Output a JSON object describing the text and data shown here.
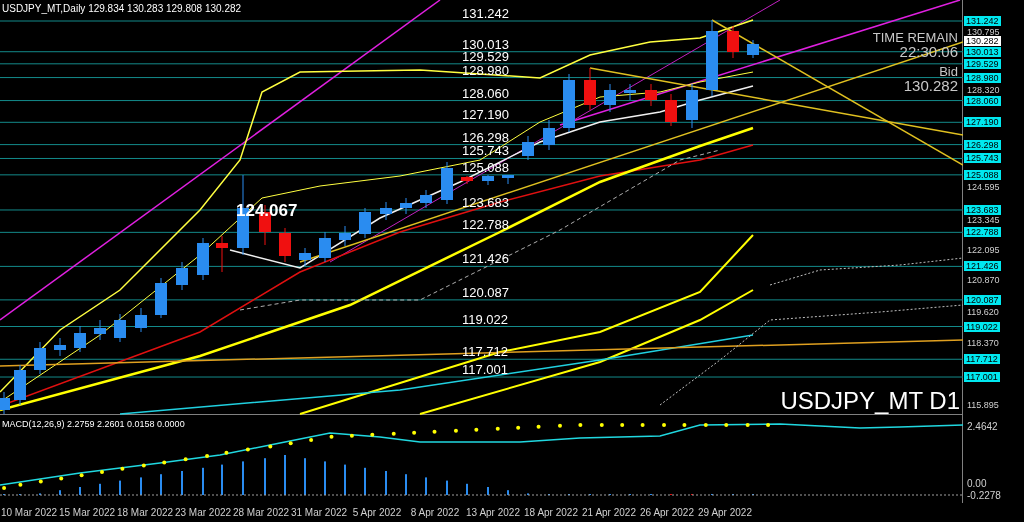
{
  "header": {
    "symbol": "USDJPY_MT,Daily",
    "ohlc": "129.834 130.283 129.808 130.282"
  },
  "levels": [
    {
      "chart_label": "131.242",
      "axis_tag": "131.242"
    },
    {
      "chart_label": "130.013",
      "axis_tag": "130.013"
    },
    {
      "chart_label": "129.529",
      "axis_tag": "129.529"
    },
    {
      "chart_label": "128.980",
      "axis_tag": "128.980"
    },
    {
      "chart_label": "128.060",
      "axis_tag": "128.060"
    },
    {
      "chart_label": "127.190",
      "axis_tag": "127.190"
    },
    {
      "chart_label": "126.298",
      "axis_tag": "126.298"
    },
    {
      "chart_label": "125.743",
      "axis_tag": "125.743"
    },
    {
      "chart_label": "125.088",
      "axis_tag": "125.088"
    },
    {
      "chart_label": "123.683",
      "axis_tag": "123.683"
    },
    {
      "chart_label": "122.788",
      "axis_tag": "122.788"
    },
    {
      "chart_label": "121.426",
      "axis_tag": "121.426"
    },
    {
      "chart_label": "120.087",
      "axis_tag": "120.087"
    },
    {
      "chart_label": "119.022",
      "axis_tag": "119.022"
    },
    {
      "chart_label": "117.712",
      "axis_tag": "117.712"
    },
    {
      "chart_label": "117.001",
      "axis_tag": "117.001"
    }
  ],
  "marker_label": "124.067",
  "price_ticks": [
    "130.795",
    "128.320",
    "124.595",
    "123.345",
    "122.095",
    "120.870",
    "119.620",
    "118.370",
    "115.895"
  ],
  "bid_tag": "130.282",
  "info": {
    "time_title": "TIME REMAIN",
    "time_value": "22:30:06",
    "bid_title": "Bid",
    "bid_value": "130.282"
  },
  "symbol_label": "USDJPY_MT D1",
  "macd": {
    "label": "MACD(12,26,9) 2.2759 2.2601 0.0158 0.0000",
    "ticks": [
      "2.4642",
      "0.00",
      "-0.2278"
    ]
  },
  "dates": [
    "10 Mar 2022",
    "15 Mar 2022",
    "18 Mar 2022",
    "23 Mar 2022",
    "28 Mar 2022",
    "31 Mar 2022",
    "5 Apr 2022",
    "8 Apr 2022",
    "13 Apr 2022",
    "18 Apr 2022",
    "21 Apr 2022",
    "26 Apr 2022",
    "29 Apr 2022"
  ]
}
